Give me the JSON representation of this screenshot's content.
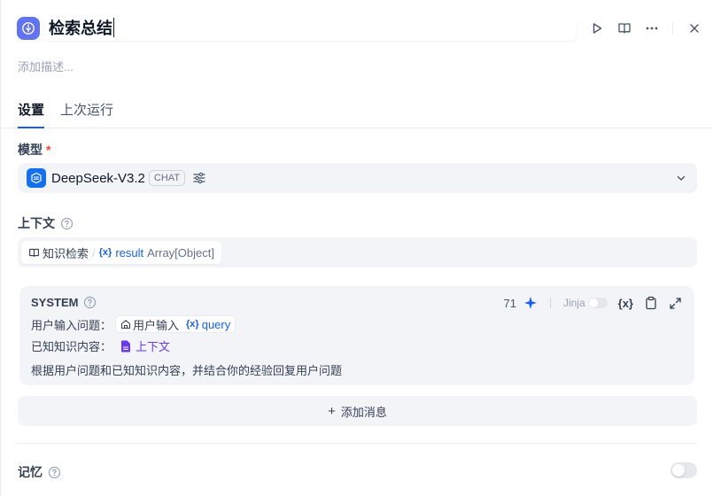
{
  "header": {
    "title": "检索总结",
    "description_placeholder": "添加描述..."
  },
  "tabs": [
    {
      "label": "设置",
      "active": true
    },
    {
      "label": "上次运行",
      "active": false
    }
  ],
  "model": {
    "label": "模型",
    "required_mark": "*",
    "name": "DeepSeek-V3.2",
    "mode_badge": "CHAT"
  },
  "context": {
    "label": "上下文",
    "variable": {
      "node": "知识检索",
      "separator": "/",
      "glyph": "{x}",
      "name": "result",
      "type": "Array[Object]"
    }
  },
  "system_prompt": {
    "role": "SYSTEM",
    "token_count": "71",
    "jinja_label": "Jinja",
    "var_glyph": "{x}",
    "line1_text": "用户输入问题：",
    "line1_chip": {
      "node": "用户输入",
      "glyph": "{x}",
      "var": "query"
    },
    "line2_text": "已知知识内容：",
    "line2_ref": "上下文",
    "line3_text": "根据用户问题和已知知识内容，并结合你的经验回复用户问题"
  },
  "add_message": {
    "plus": "+",
    "label": "添加消息"
  },
  "memory": {
    "label": "记忆",
    "enabled": false
  },
  "colors": {
    "accent": "#155eef",
    "node_icon": "#6172f3",
    "model_logo": "#1570ef",
    "context_ref": "#6938ef",
    "required": "#f04438"
  }
}
